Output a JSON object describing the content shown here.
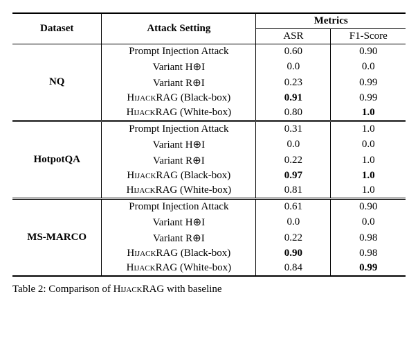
{
  "header": {
    "dataset": "Dataset",
    "attack": "Attack Setting",
    "metrics": "Metrics",
    "asr": "ASR",
    "f1": "F1-Score"
  },
  "new_method": "HijackRAG",
  "rows_common": {
    "prompt_injection": "Prompt Injection Attack",
    "variant_hi_pre": "Variant H",
    "variant_ri_pre": "Variant R",
    "variant_suf": "I",
    "hijack_black_suf": " (Black-box)",
    "hijack_white_suf": " (White-box)"
  },
  "groups": [
    {
      "dataset": "NQ",
      "rows": [
        {
          "asr": "0.60",
          "f1": "0.90",
          "asr_bold": false,
          "f1_bold": false
        },
        {
          "asr": "0.0",
          "f1": "0.0",
          "asr_bold": false,
          "f1_bold": false
        },
        {
          "asr": "0.23",
          "f1": "0.99",
          "asr_bold": false,
          "f1_bold": false
        },
        {
          "asr": "0.91",
          "f1": "0.99",
          "asr_bold": true,
          "f1_bold": false
        },
        {
          "asr": "0.80",
          "f1": "1.0",
          "asr_bold": false,
          "f1_bold": true
        }
      ]
    },
    {
      "dataset": "HotpotQA",
      "rows": [
        {
          "asr": "0.31",
          "f1": "1.0",
          "asr_bold": false,
          "f1_bold": false
        },
        {
          "asr": "0.0",
          "f1": "0.0",
          "asr_bold": false,
          "f1_bold": false
        },
        {
          "asr": "0.22",
          "f1": "1.0",
          "asr_bold": false,
          "f1_bold": false
        },
        {
          "asr": "0.97",
          "f1": "1.0",
          "asr_bold": true,
          "f1_bold": true
        },
        {
          "asr": "0.81",
          "f1": "1.0",
          "asr_bold": false,
          "f1_bold": false
        }
      ]
    },
    {
      "dataset": "MS-MARCO",
      "rows": [
        {
          "asr": "0.61",
          "f1": "0.90",
          "asr_bold": false,
          "f1_bold": false
        },
        {
          "asr": "0.0",
          "f1": "0.0",
          "asr_bold": false,
          "f1_bold": false
        },
        {
          "asr": "0.22",
          "f1": "0.98",
          "asr_bold": false,
          "f1_bold": false
        },
        {
          "asr": "0.90",
          "f1": "0.98",
          "asr_bold": true,
          "f1_bold": false
        },
        {
          "asr": "0.84",
          "f1": "0.99",
          "asr_bold": false,
          "f1_bold": true
        }
      ]
    }
  ],
  "oplus": "⊕",
  "caption_prefix": "Table 2: Comparison of ",
  "caption_suffix": " with baseline",
  "chart_data": {
    "type": "table",
    "columns": [
      "Dataset",
      "Attack Setting",
      "ASR",
      "F1-Score"
    ],
    "data": [
      [
        "NQ",
        "Prompt Injection Attack",
        0.6,
        0.9
      ],
      [
        "NQ",
        "Variant H⊕I",
        0.0,
        0.0
      ],
      [
        "NQ",
        "Variant R⊕I",
        0.23,
        0.99
      ],
      [
        "NQ",
        "HijackRAG (Black-box)",
        0.91,
        0.99
      ],
      [
        "NQ",
        "HijackRAG (White-box)",
        0.8,
        1.0
      ],
      [
        "HotpotQA",
        "Prompt Injection Attack",
        0.31,
        1.0
      ],
      [
        "HotpotQA",
        "Variant H⊕I",
        0.0,
        0.0
      ],
      [
        "HotpotQA",
        "Variant R⊕I",
        0.22,
        1.0
      ],
      [
        "HotpotQA",
        "HijackRAG (Black-box)",
        0.97,
        1.0
      ],
      [
        "HotpotQA",
        "HijackRAG (White-box)",
        0.81,
        1.0
      ],
      [
        "MS-MARCO",
        "Prompt Injection Attack",
        0.61,
        0.9
      ],
      [
        "MS-MARCO",
        "Variant H⊕I",
        0.0,
        0.0
      ],
      [
        "MS-MARCO",
        "Variant R⊕I",
        0.22,
        0.98
      ],
      [
        "MS-MARCO",
        "HijackRAG (Black-box)",
        0.9,
        0.98
      ],
      [
        "MS-MARCO",
        "HijackRAG (White-box)",
        0.84,
        0.99
      ]
    ]
  }
}
